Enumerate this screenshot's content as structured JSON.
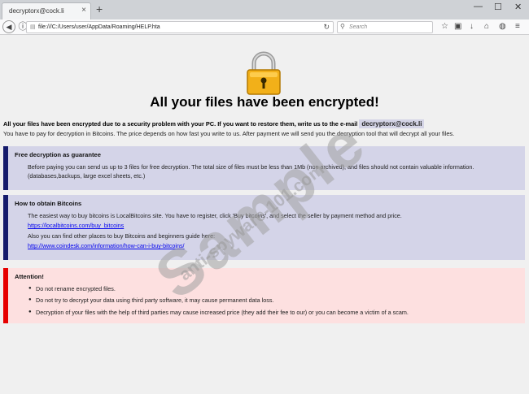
{
  "browser": {
    "tab_title": "decryptorx@cock.li",
    "tab_close": "×",
    "new_tab": "+",
    "win_minimize": "—",
    "win_maximize": "☐",
    "win_close": "✕",
    "url": "file:///C:/Users/user/AppData/Roaming/HELP.hta",
    "search_placeholder": "Search"
  },
  "page": {
    "heading": "All your files have been encrypted!",
    "intro_bold": "All your files have been encrypted due to a security problem with your PC. If you want to restore them, write us to the e-mail",
    "email": "decryptorx@cock.li",
    "intro_line2": "You have to pay for decryption in Bitcoins. The price depends on how fast you write to us. After payment we will send you the decryption tool that will decrypt all your files.",
    "free": {
      "title": "Free decryption as guarantee",
      "text": "Before paying you can send us up to 3 files for free decryption. The total size of files must be less than 1Mb (non archived), and files should not contain valuable information. (databases,backups, large excel sheets, etc.)"
    },
    "bitcoins": {
      "title": "How to obtain Bitcoins",
      "text1": "The easiest way to buy bitcoins is LocalBitcoins site. You have to register, click 'Buy bitcoins', and select the seller by payment method and price.",
      "link1": "https://localbitcoins.com/buy_bitcoins",
      "text2": "Also you can find other places to buy Bitcoins and beginners guide here:",
      "link2": "http://www.coindesk.com/information/how-can-i-buy-bitcoins/"
    },
    "attention": {
      "title": "Attention!",
      "items": [
        "Do not rename encrypted files.",
        "Do not try to decrypt your data using third party software, it may cause permanent data loss.",
        "Decryption of your files with the help of third parties may cause increased price (they add their fee to our) or you can become a victim of a scam."
      ]
    }
  },
  "watermark": {
    "big": "Sample",
    "small": "anti-spyware-101.com"
  }
}
